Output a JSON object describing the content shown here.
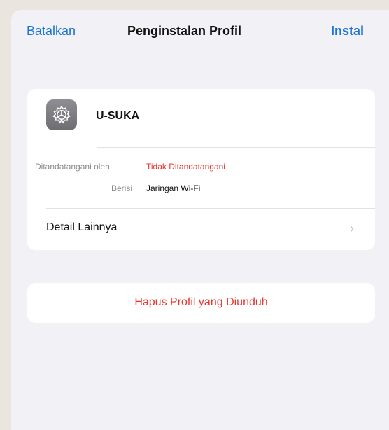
{
  "navbar": {
    "cancel_label": "Batalkan",
    "title": "Penginstalan Profil",
    "install_label": "Instal"
  },
  "profile": {
    "icon": "gear-icon",
    "name": "U-SUKA"
  },
  "details": {
    "signed_by_label": "Ditandatangani oleh",
    "signed_by_value": "Tidak Ditandatangani",
    "contains_label": "Berisi",
    "contains_value": "Jaringan Wi-Fi",
    "more_details_label": "Detail Lainnya",
    "chevron": "›"
  },
  "actions": {
    "delete_label": "Hapus Profil yang Diunduh"
  },
  "colors": {
    "accent": "#1a73d6",
    "destructive": "#e8352e",
    "background": "#f2f1f6"
  }
}
